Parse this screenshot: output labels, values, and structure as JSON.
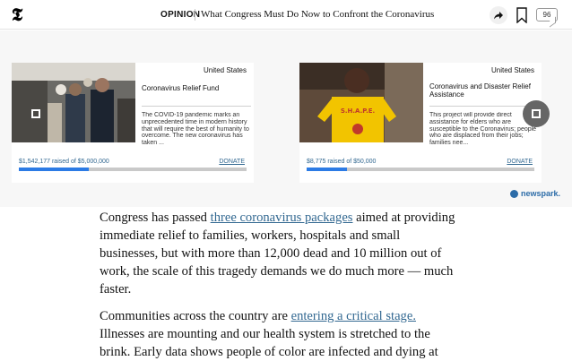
{
  "header": {
    "section": "OPINION",
    "headline": "What Congress Must Do Now to Confront the Coronavirus",
    "comment_count": "96"
  },
  "widget": {
    "brand": "newspark.",
    "cards": [
      {
        "country": "United States",
        "title": "Coronavirus Relief Fund",
        "description": "The COVID-19 pandemic marks an unprecedented time in modern history that will require the best of humanity to overcome. The new coronavirus has taken ...",
        "raised": "$1,542,177 raised of $5,000,000",
        "progress": 0.308,
        "donate": "DONATE"
      },
      {
        "country": "United States",
        "title": "Coronavirus and Disaster Relief Assistance",
        "description": "This project will provide direct assistance for elders who are susceptible to the Coronavirus; people who are displaced from their jobs; families nee...",
        "raised": "$8,775 raised of $50,000",
        "progress": 0.1755,
        "donate": "DONATE"
      }
    ],
    "photo2_shirt_text": "S.H.A.P.E."
  },
  "article": {
    "p1_before": "Congress has passed ",
    "p1_link": "three coronavirus packages",
    "p1_after": " aimed at providing immediate relief to families, workers, hospitals and small businesses, but with more than 12,000 dead and 10 million out of work, the scale of this tragedy demands we do much more — much faster.",
    "p2_before": "Communities across the country are ",
    "p2_link": "entering a critical stage.",
    "p2_after": " Illnesses are mounting and our health system is stretched to the brink. Early data shows people of color are infected and dying at"
  },
  "colors": {
    "link": "#326891",
    "progress": "#2c7be5",
    "brand": "#2c6ca8"
  }
}
